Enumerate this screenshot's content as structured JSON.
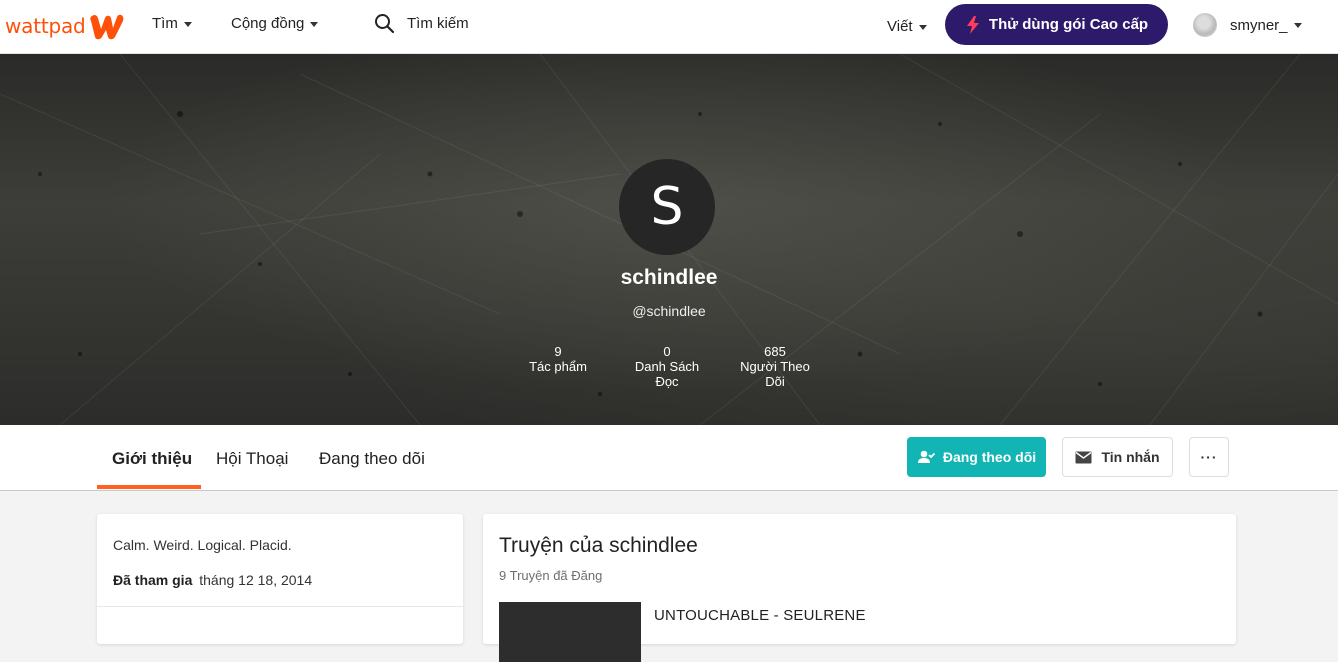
{
  "colors": {
    "brand": "#ff500a",
    "premium": "#2d1a6b",
    "follow": "#12b5b3",
    "tab_underline": "#ff6122"
  },
  "nav": {
    "logo_text": "wattpad",
    "browse_label": "Tìm",
    "community_label": "Cộng đồng",
    "search_placeholder": "Tìm kiếm",
    "write_label": "Viết",
    "premium_label": "Thử dùng gói Cao cấp",
    "username": "smyner_"
  },
  "profile": {
    "avatar_letter": "S",
    "display_name": "schindlee",
    "handle": "@schindlee",
    "stats": [
      {
        "value": "9",
        "label_line1": "Tác phẩm",
        "label_line2": ""
      },
      {
        "value": "0",
        "label_line1": "Danh Sách",
        "label_line2": "Đọc"
      },
      {
        "value": "685",
        "label_line1": "Người Theo",
        "label_line2": "Dõi"
      }
    ]
  },
  "tabs": {
    "about": "Giới thiệu",
    "conversations": "Hội Thoại",
    "following": "Đang theo dõi",
    "active": "about"
  },
  "actions": {
    "follow_label": "Đang theo dõi",
    "message_label": "Tin nhắn",
    "more_label": "···"
  },
  "about": {
    "bio": "Calm. Weird. Logical. Placid.",
    "joined_label": "Đã tham gia",
    "joined_date": "tháng 12 18, 2014"
  },
  "stories": {
    "title": "Truyện của schindlee",
    "count": "9 Truyện đã Đăng",
    "items": [
      {
        "title": "UNTOUCHABLE - SEULRENE"
      }
    ]
  }
}
